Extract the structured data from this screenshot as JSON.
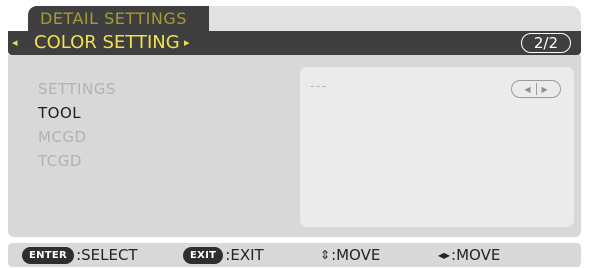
{
  "tab": {
    "label": "DETAIL SETTINGS"
  },
  "header": {
    "arrow_left": "◂",
    "title": "COLOR SETTING",
    "arrow_right": "▸",
    "page": "2/2"
  },
  "menu": {
    "items": [
      {
        "label": "SETTINGS",
        "state": "disabled"
      },
      {
        "label": "TOOL",
        "state": "enabled"
      },
      {
        "label": "MCGD",
        "state": "disabled"
      },
      {
        "label": "TCGD",
        "state": "disabled"
      }
    ]
  },
  "value": {
    "text": "---",
    "left_arrow": "◀",
    "right_arrow": "▶"
  },
  "footer": {
    "enter_key": "ENTER",
    "enter_action": ":SELECT",
    "exit_key": "EXIT",
    "exit_action": ":EXIT",
    "move_updown_glyph": "⇕",
    "move_updown_action": ":MOVE",
    "move_leftright_glyph": "◂▸",
    "move_leftright_action": ":MOVE"
  },
  "colors": {
    "title_yellow": "#f1e14a",
    "tab_text": "#a79c32",
    "header_bg": "#3f3f3f",
    "panel_bg": "#d8d8d8",
    "disabled_text": "#b2b2b2",
    "enabled_text": "#1e1e1e"
  }
}
